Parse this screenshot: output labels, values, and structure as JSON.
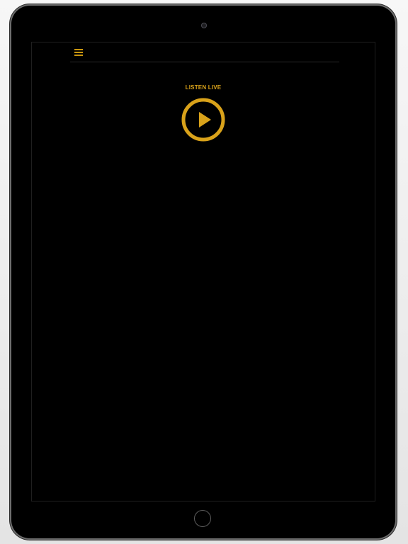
{
  "player": {
    "live_label": "LISTEN LIVE"
  },
  "icons": {
    "menu": "hamburger-menu-icon",
    "play": "play-icon"
  },
  "colors": {
    "accent": "#d9a21a",
    "background": "#000000"
  }
}
